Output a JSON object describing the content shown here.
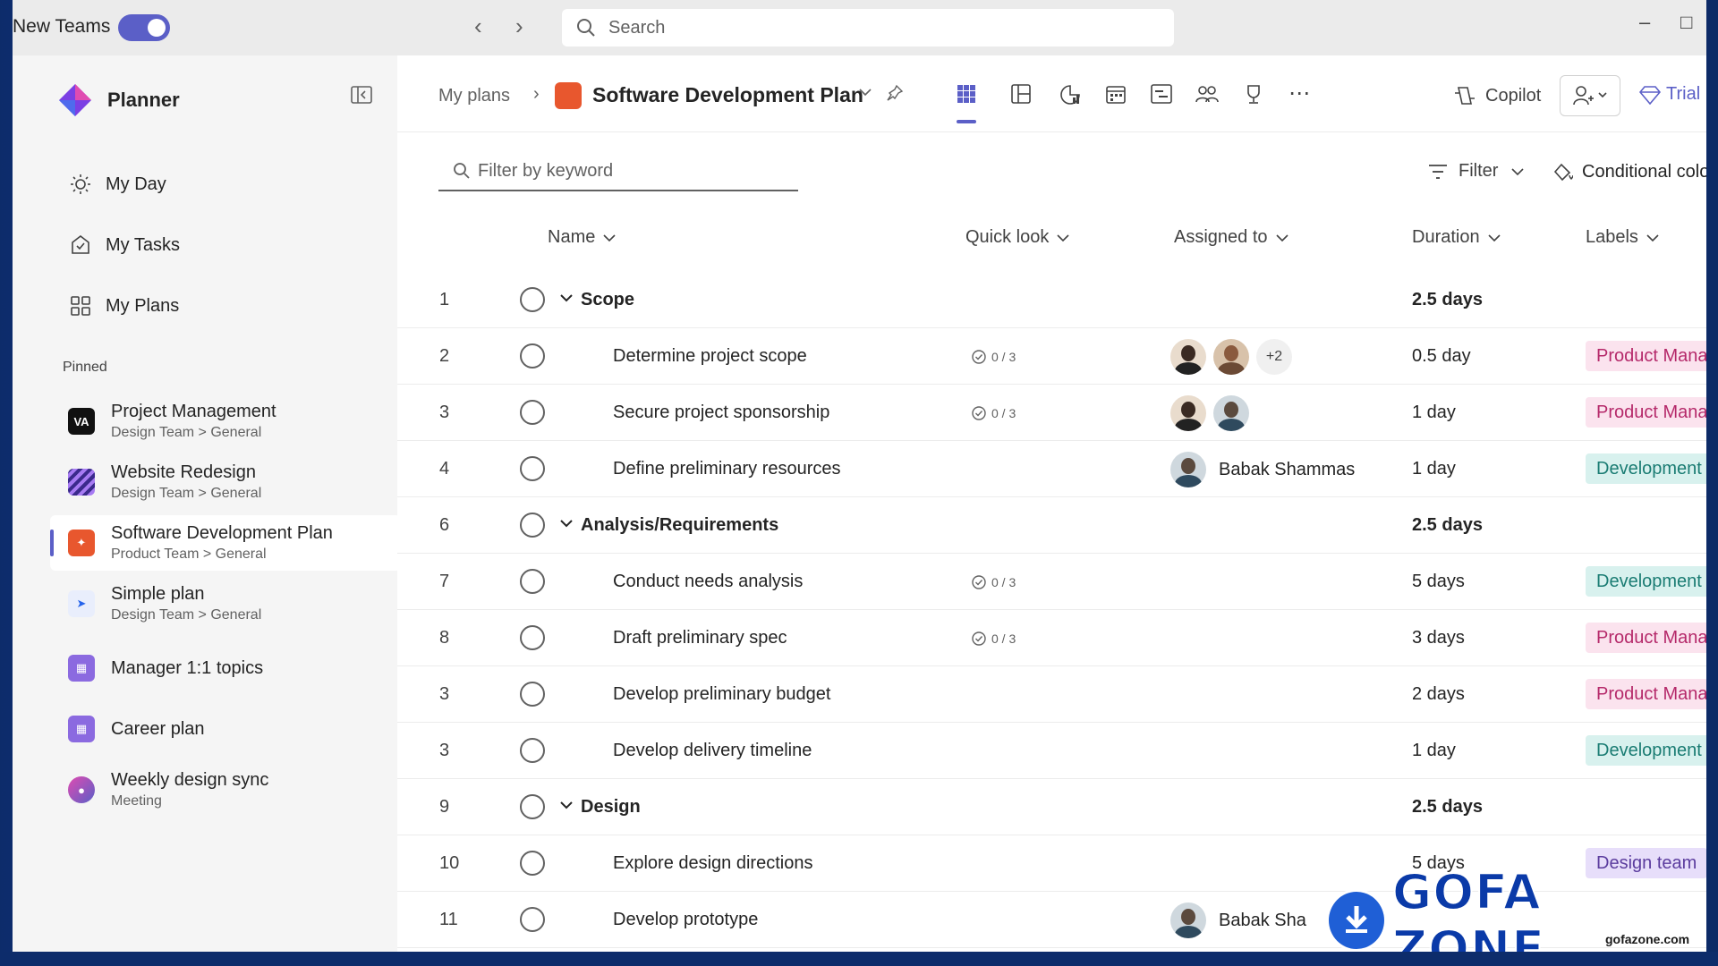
{
  "titlebar": {
    "new_teams_label": "New Teams",
    "search_placeholder": "Search"
  },
  "sidebar": {
    "app_name": "Planner",
    "nav": [
      {
        "label": "My Day",
        "icon": "sun-icon"
      },
      {
        "label": "My Tasks",
        "icon": "task-check-icon"
      },
      {
        "label": "My Plans",
        "icon": "grid-icon"
      }
    ],
    "pinned_label": "Pinned",
    "pinned": [
      {
        "title": "Project Management",
        "subtitle": "Design Team > General",
        "color": "#111111"
      },
      {
        "title": "Website Redesign",
        "subtitle": "Design Team > General",
        "color": "#3b2a8c"
      },
      {
        "title": "Software Development Plan",
        "subtitle": "Product Team > General",
        "color": "#e8572e"
      },
      {
        "title": "Simple plan",
        "subtitle": "Design Team > General",
        "color": "#2563eb"
      },
      {
        "title": "Manager 1:1 topics",
        "subtitle": "",
        "color": "#8b6ae0"
      },
      {
        "title": "Career plan",
        "subtitle": "",
        "color": "#8b6ae0"
      },
      {
        "title": "Weekly design sync",
        "subtitle": "Meeting",
        "color": "#7b3fe4"
      }
    ]
  },
  "header": {
    "breadcrumb": "My plans",
    "plan_title": "Software Development Plan",
    "copilot_label": "Copilot",
    "trial_label": "Trial"
  },
  "toolbar": {
    "filter_placeholder": "Filter by keyword",
    "filter_label": "Filter",
    "conditional_label": "Conditional colo"
  },
  "columns": {
    "name": "Name",
    "quick_look": "Quick look",
    "assigned_to": "Assigned to",
    "duration": "Duration",
    "labels": "Labels"
  },
  "rows": [
    {
      "num": "1",
      "name": "Scope",
      "group": true,
      "duration": "2.5 days"
    },
    {
      "num": "2",
      "name": "Determine project scope",
      "quick_look": "0 / 3",
      "duration": "0.5 day",
      "label": "Product Manag",
      "label_style": "pink",
      "extra": "+2"
    },
    {
      "num": "3",
      "name": "Secure project sponsorship",
      "quick_look": "0 / 3",
      "duration": "1 day",
      "label": "Product Manag",
      "label_style": "pink"
    },
    {
      "num": "4",
      "name": "Define preliminary resources",
      "duration": "1 day",
      "label": "Development te",
      "label_style": "teal",
      "assignee": "Babak Shammas"
    },
    {
      "num": "6",
      "name": "Analysis/Requirements",
      "group": true,
      "duration": "2.5 days"
    },
    {
      "num": "7",
      "name": "Conduct needs analysis",
      "quick_look": "0 / 3",
      "duration": "5 days",
      "label": "Development te",
      "label_style": "teal"
    },
    {
      "num": "8",
      "name": "Draft preliminary spec",
      "quick_look": "0 / 3",
      "duration": "3 days",
      "label": "Product Manag",
      "label_style": "pink"
    },
    {
      "num": "3",
      "name": "Develop preliminary budget",
      "duration": "2 days",
      "label": "Product Manag",
      "label_style": "pink"
    },
    {
      "num": "3",
      "name": "Develop delivery timeline",
      "duration": "1 day",
      "label": "Development te",
      "label_style": "teal"
    },
    {
      "num": "9",
      "name": "Design",
      "group": true,
      "duration": "2.5 days"
    },
    {
      "num": "10",
      "name": "Explore design directions",
      "duration": "5 days",
      "label": "Design team",
      "label_style": "purple"
    },
    {
      "num": "11",
      "name": "Develop prototype",
      "assignee": "Babak Sha"
    }
  ],
  "label_colors": {
    "pink": {
      "bg": "#fbe3ee",
      "fg": "#b5296a"
    },
    "teal": {
      "bg": "#d8f1ee",
      "fg": "#1a7c73"
    },
    "purple": {
      "bg": "#e7defa",
      "fg": "#5b3c9e"
    }
  },
  "watermark": {
    "brand": "GOFA ZONE",
    "url": "gofazone.com"
  },
  "colors": {
    "accent": "#5b5fc7",
    "plan_orange": "#e8572e"
  }
}
